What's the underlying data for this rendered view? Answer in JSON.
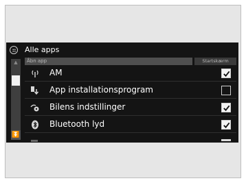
{
  "screen": {
    "title": "Alle apps",
    "header_left": "Åbn app",
    "header_right": "Startskærm"
  },
  "icons": {
    "apps": "apps-grid-icon",
    "scroll_down": "chevron-double-down-icon"
  },
  "apps": [
    {
      "label": "AM",
      "icon": "radio-antenna-icon",
      "checked": true
    },
    {
      "label": "App installationsprogram",
      "icon": "app-installer-icon",
      "checked": false
    },
    {
      "label": "Bilens indstillinger",
      "icon": "car-settings-icon",
      "checked": true
    },
    {
      "label": "Bluetooth lyd",
      "icon": "bluetooth-icon",
      "checked": true
    }
  ]
}
